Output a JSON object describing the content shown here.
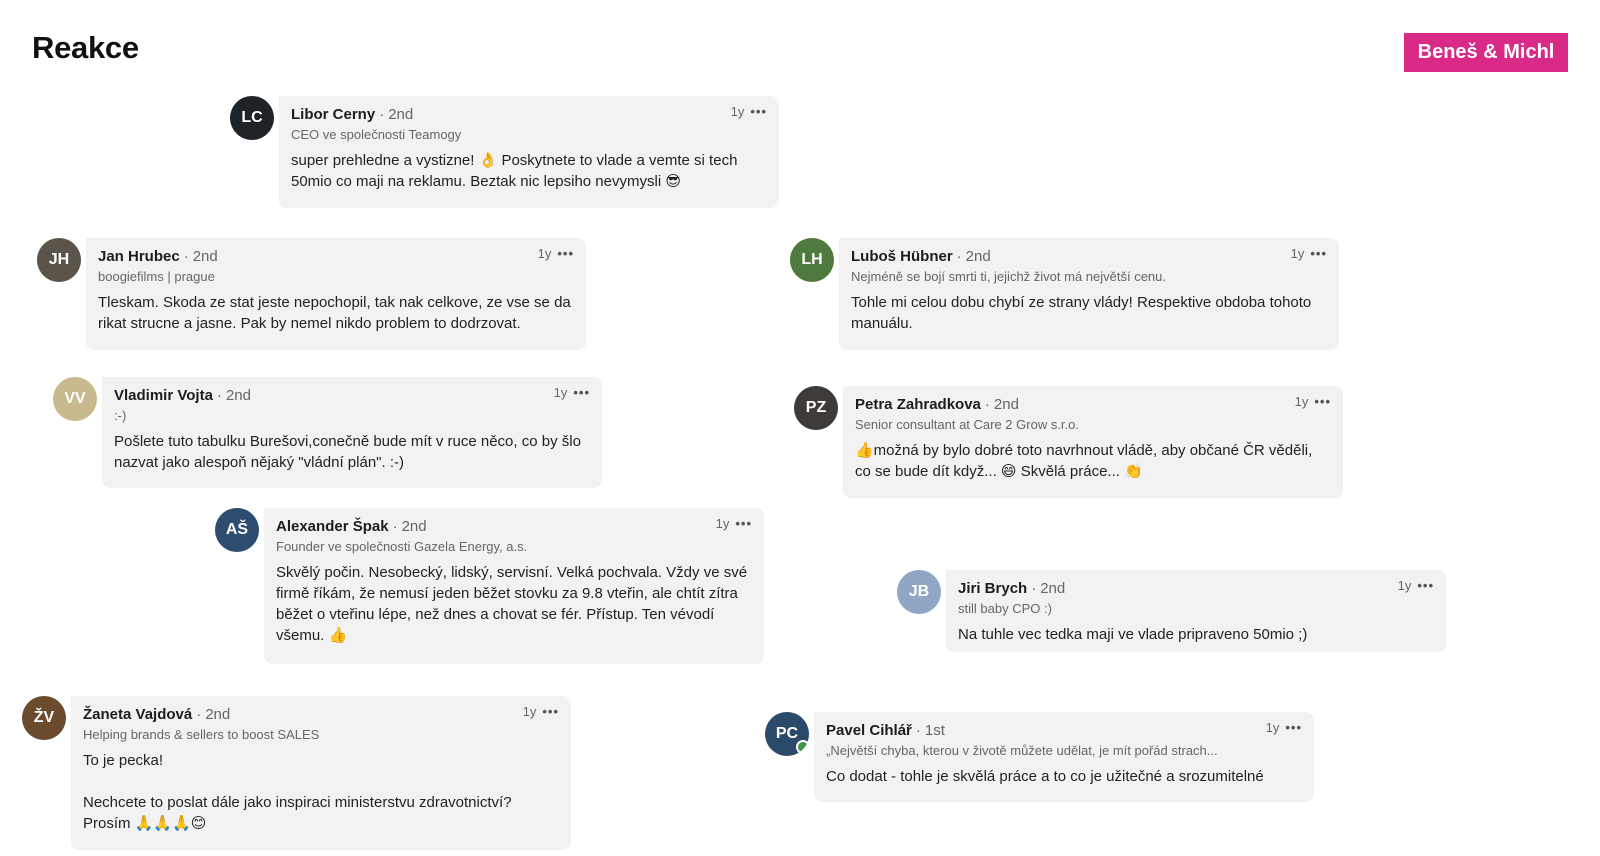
{
  "page_title": "Reakce",
  "brand": "Beneš & Michl",
  "time": "1y",
  "comments": [
    {
      "name": "Libor Cerny",
      "degree": "2nd",
      "subtitle": "CEO ve společnosti Teamogy",
      "text": "super prehledne a vystizne! 👌 Poskytnete to vlade a vemte si tech 50mio co maji na reklamu. Beztak nic lepsiho nevymysli 😎",
      "initials": "LC",
      "avatar_color": "#1e2328"
    },
    {
      "name": "Jan Hrubec",
      "degree": "2nd",
      "subtitle": "boogiefilms | prague",
      "text": "Tleskam. Skoda ze stat jeste nepochopil, tak nak celkove, ze vse se da rikat strucne a jasne. Pak by nemel nikdo problem to dodrzovat.",
      "initials": "JH",
      "avatar_color": "#5a544b"
    },
    {
      "name": "Luboš Hübner",
      "degree": "2nd",
      "subtitle": "Nejméně se bojí smrti ti, jejichž život má největší cenu.",
      "text": "Tohle mi celou dobu chybí ze strany vlády! Respektive obdoba tohoto manuálu.",
      "initials": "LH",
      "avatar_color": "#4f7a3e"
    },
    {
      "name": "Vladimir Vojta",
      "degree": "2nd",
      "subtitle": ":-)",
      "text": "Pošlete tuto tabulku Burešovi,conečně bude mít v ruce něco, co by šlo nazvat jako alespoň nějaký \"vládní plán\". :-)",
      "initials": "VV",
      "avatar_color": "#c9b98e"
    },
    {
      "name": "Petra Zahradkova",
      "degree": "2nd",
      "subtitle": "Senior consultant at Care 2 Grow s.r.o.",
      "text": "👍možná by bylo dobré toto navrhnout vládě, aby občané ČR věděli, co se bude dít když... 😄 Skvělá práce... 👏",
      "initials": "PZ",
      "avatar_color": "#3d3a38"
    },
    {
      "name": "Alexander Špak",
      "degree": "2nd",
      "subtitle": "Founder ve společnosti Gazela Energy, a.s.",
      "text": "Skvělý počin. Nesobecký, lidský, servisní. Velká pochvala. Vždy ve své firmě říkám, že nemusí jeden běžet stovku za 9.8 vteřin, ale chtít zítra běžet o vteřinu lépe, než dnes a chovat se fér. Přístup. Ten vévodí všemu. 👍",
      "initials": "AŠ",
      "avatar_color": "#2e4d6e"
    },
    {
      "name": "Jiri Brych",
      "degree": "2nd",
      "subtitle": "still baby CPO :)",
      "text": "Na tuhle vec tedka maji ve vlade pripraveno 50mio ;)",
      "initials": "JB",
      "avatar_color": "#8fa7c4"
    },
    {
      "name": "Žaneta Vajdová",
      "degree": "2nd",
      "subtitle": "Helping brands & sellers to boost SALES",
      "text": "To je pecka!\n\nNechcete to poslat dále jako inspiraci ministerstvu zdravotnictví? Prosím 🙏🙏🙏😊",
      "initials": "ŽV",
      "avatar_color": "#6b4a2e"
    },
    {
      "name": "Pavel Cihlář",
      "degree": "1st",
      "subtitle": "„Největší chyba, kterou v životě můžete udělat, je mít pořád strach...",
      "text": "Co dodat - tohle je skvělá práce a to co je užitečné a srozumitelné",
      "initials": "PC",
      "avatar_color": "#2b4a6a"
    }
  ]
}
